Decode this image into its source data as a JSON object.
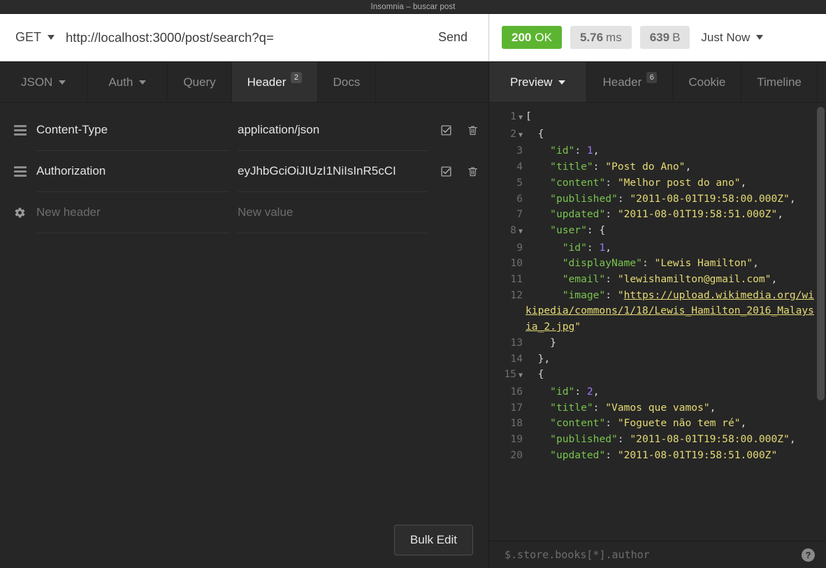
{
  "window": {
    "title": "Insomnia – buscar post"
  },
  "request": {
    "method": "GET",
    "url": "http://localhost:3000/post/search?q=",
    "send_label": "Send",
    "tabs": [
      {
        "label": "JSON",
        "badge": "",
        "caret": true,
        "active": false
      },
      {
        "label": "Auth",
        "badge": "",
        "caret": true,
        "active": false
      },
      {
        "label": "Query",
        "badge": "",
        "caret": false,
        "active": false
      },
      {
        "label": "Header",
        "badge": "2",
        "caret": false,
        "active": true
      },
      {
        "label": "Docs",
        "badge": "",
        "caret": false,
        "active": false
      }
    ],
    "headers": [
      {
        "name": "Content-Type",
        "value": "application/json",
        "enabled": true
      },
      {
        "name": "Authorization",
        "value": "eyJhbGciOiJIUzI1NiIsInR5cCI",
        "enabled": true
      }
    ],
    "new_header_placeholder": "New header",
    "new_value_placeholder": "New value",
    "bulk_edit_label": "Bulk Edit"
  },
  "response": {
    "status_code": "200",
    "status_text": "OK",
    "time_value": "5.76",
    "time_unit": "ms",
    "size_value": "639",
    "size_unit": "B",
    "history_label": "Just Now",
    "tabs": [
      {
        "label": "Preview",
        "badge": "",
        "caret": true,
        "active": true
      },
      {
        "label": "Header",
        "badge": "6",
        "caret": false,
        "active": false
      },
      {
        "label": "Cookie",
        "badge": "",
        "caret": false,
        "active": false
      },
      {
        "label": "Timeline",
        "badge": "",
        "caret": false,
        "active": false
      }
    ],
    "filter_placeholder": "$.store.books[*].author",
    "body_lines": [
      {
        "num": "1",
        "fold": true,
        "indent": 0,
        "tokens": [
          {
            "t": "p",
            "v": "["
          }
        ]
      },
      {
        "num": "2",
        "fold": true,
        "indent": 1,
        "tokens": [
          {
            "t": "p",
            "v": "{"
          }
        ]
      },
      {
        "num": "3",
        "fold": false,
        "indent": 2,
        "tokens": [
          {
            "t": "k",
            "v": "\"id\""
          },
          {
            "t": "p",
            "v": ": "
          },
          {
            "t": "n",
            "v": "1"
          },
          {
            "t": "p",
            "v": ","
          }
        ]
      },
      {
        "num": "4",
        "fold": false,
        "indent": 2,
        "tokens": [
          {
            "t": "k",
            "v": "\"title\""
          },
          {
            "t": "p",
            "v": ": "
          },
          {
            "t": "s",
            "v": "\"Post do Ano\""
          },
          {
            "t": "p",
            "v": ","
          }
        ]
      },
      {
        "num": "5",
        "fold": false,
        "indent": 2,
        "tokens": [
          {
            "t": "k",
            "v": "\"content\""
          },
          {
            "t": "p",
            "v": ": "
          },
          {
            "t": "s",
            "v": "\"Melhor post do ano\""
          },
          {
            "t": "p",
            "v": ","
          }
        ]
      },
      {
        "num": "6",
        "fold": false,
        "indent": 2,
        "tokens": [
          {
            "t": "k",
            "v": "\"published\""
          },
          {
            "t": "p",
            "v": ": "
          },
          {
            "t": "s",
            "v": "\"2011-08-01T19:58:00.000Z\""
          },
          {
            "t": "p",
            "v": ","
          }
        ]
      },
      {
        "num": "7",
        "fold": false,
        "indent": 2,
        "tokens": [
          {
            "t": "k",
            "v": "\"updated\""
          },
          {
            "t": "p",
            "v": ": "
          },
          {
            "t": "s",
            "v": "\"2011-08-01T19:58:51.000Z\""
          },
          {
            "t": "p",
            "v": ","
          }
        ]
      },
      {
        "num": "8",
        "fold": true,
        "indent": 2,
        "tokens": [
          {
            "t": "k",
            "v": "\"user\""
          },
          {
            "t": "p",
            "v": ": {"
          }
        ]
      },
      {
        "num": "9",
        "fold": false,
        "indent": 3,
        "tokens": [
          {
            "t": "k",
            "v": "\"id\""
          },
          {
            "t": "p",
            "v": ": "
          },
          {
            "t": "n",
            "v": "1"
          },
          {
            "t": "p",
            "v": ","
          }
        ]
      },
      {
        "num": "10",
        "fold": false,
        "indent": 3,
        "tokens": [
          {
            "t": "k",
            "v": "\"displayName\""
          },
          {
            "t": "p",
            "v": ": "
          },
          {
            "t": "s",
            "v": "\"Lewis Hamilton\""
          },
          {
            "t": "p",
            "v": ","
          }
        ]
      },
      {
        "num": "11",
        "fold": false,
        "indent": 3,
        "tokens": [
          {
            "t": "k",
            "v": "\"email\""
          },
          {
            "t": "p",
            "v": ": "
          },
          {
            "t": "s",
            "v": "\"lewishamilton@gmail.com\""
          },
          {
            "t": "p",
            "v": ","
          }
        ]
      },
      {
        "num": "12",
        "fold": false,
        "indent": 3,
        "tokens": [
          {
            "t": "k",
            "v": "\"image\""
          },
          {
            "t": "p",
            "v": ": "
          },
          {
            "t": "s",
            "v": "\""
          },
          {
            "t": "lnk",
            "v": "https://upload.wikimedia.org/wikipedia/commons/1/18/Lewis_Hamilton_2016_Malaysia_2.jpg"
          },
          {
            "t": "s",
            "v": "\""
          }
        ]
      },
      {
        "num": "13",
        "fold": false,
        "indent": 2,
        "tokens": [
          {
            "t": "p",
            "v": "}"
          }
        ]
      },
      {
        "num": "14",
        "fold": false,
        "indent": 1,
        "tokens": [
          {
            "t": "p",
            "v": "},"
          }
        ]
      },
      {
        "num": "15",
        "fold": true,
        "indent": 1,
        "tokens": [
          {
            "t": "p",
            "v": "{"
          }
        ]
      },
      {
        "num": "16",
        "fold": false,
        "indent": 2,
        "tokens": [
          {
            "t": "k",
            "v": "\"id\""
          },
          {
            "t": "p",
            "v": ": "
          },
          {
            "t": "n",
            "v": "2"
          },
          {
            "t": "p",
            "v": ","
          }
        ]
      },
      {
        "num": "17",
        "fold": false,
        "indent": 2,
        "tokens": [
          {
            "t": "k",
            "v": "\"title\""
          },
          {
            "t": "p",
            "v": ": "
          },
          {
            "t": "s",
            "v": "\"Vamos que vamos\""
          },
          {
            "t": "p",
            "v": ","
          }
        ]
      },
      {
        "num": "18",
        "fold": false,
        "indent": 2,
        "tokens": [
          {
            "t": "k",
            "v": "\"content\""
          },
          {
            "t": "p",
            "v": ": "
          },
          {
            "t": "s",
            "v": "\"Foguete não tem ré\""
          },
          {
            "t": "p",
            "v": ","
          }
        ]
      },
      {
        "num": "19",
        "fold": false,
        "indent": 2,
        "tokens": [
          {
            "t": "k",
            "v": "\"published\""
          },
          {
            "t": "p",
            "v": ": "
          },
          {
            "t": "s",
            "v": "\"2011-08-01T19:58:00.000Z\""
          },
          {
            "t": "p",
            "v": ","
          }
        ]
      },
      {
        "num": "20",
        "fold": false,
        "indent": 2,
        "tokens": [
          {
            "t": "k",
            "v": "\"updated\""
          },
          {
            "t": "p",
            "v": ": "
          },
          {
            "t": "s",
            "v": "\"2011-08-01T19:58:51.000Z\""
          }
        ]
      }
    ]
  },
  "colors": {
    "status_ok": "#5cb531",
    "json_key": "#79c44d",
    "json_string": "#e6db74",
    "json_number": "#a277ff",
    "background": "#262626"
  }
}
